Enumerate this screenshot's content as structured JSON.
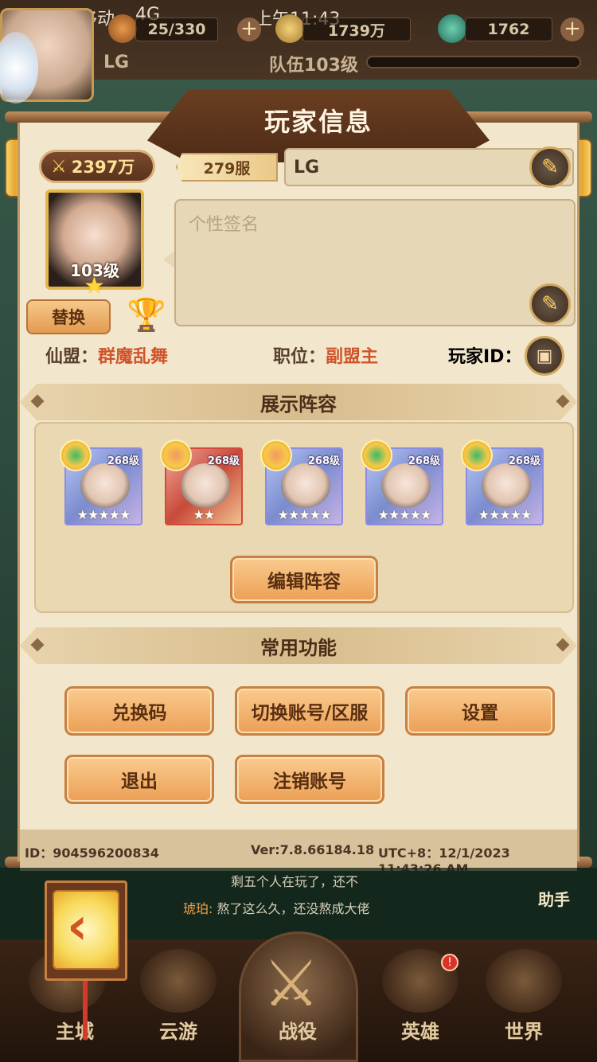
{
  "status": {
    "carrier": "中国移动",
    "network": "4G",
    "time": "上午11:43"
  },
  "top": {
    "stamina": "25/330",
    "gold": "1739万",
    "gems": "1762",
    "player_name": "LG",
    "team_level": "队伍103级"
  },
  "panel": {
    "title": "玩家信息",
    "power": "2397万",
    "server": "279服",
    "name": "LG",
    "portrait_level": "103级",
    "signature_placeholder": "个性签名",
    "swap_label": "替换",
    "alliance_label": "仙盟：",
    "alliance_value": "群魔乱舞",
    "position_label": "职位：",
    "position_value": "副盟主",
    "player_id_label": "玩家ID：",
    "lineup_title": "展示阵容",
    "heroes": [
      {
        "level": "268级",
        "stars": "★★★★★"
      },
      {
        "level": "268级",
        "stars": "★★"
      },
      {
        "level": "268级",
        "stars": "★★★★★"
      },
      {
        "level": "268级",
        "stars": "★★★★★"
      },
      {
        "level": "268级",
        "stars": "★★★★★"
      }
    ],
    "edit_lineup": "编辑阵容",
    "functions_title": "常用功能",
    "buttons": {
      "redeem": "兑换码",
      "switch_account": "切换账号/区服",
      "settings": "设置",
      "logout": "退出",
      "delete_account": "注销账号"
    },
    "footer": {
      "id": "ID：904596200834",
      "version": "Ver:7.8.66184.18",
      "time": "UTC+8：12/1/2023 11:43:26 AM"
    }
  },
  "chat": {
    "line1": "剩五个人在玩了，还不",
    "name": "琥珀:",
    "line2": "熬了这么久，还没熬成大佬",
    "helper": "助手"
  },
  "nav": {
    "items": [
      "主城",
      "云游",
      "战役",
      "英雄",
      "世界"
    ],
    "hero_badge": "!"
  }
}
